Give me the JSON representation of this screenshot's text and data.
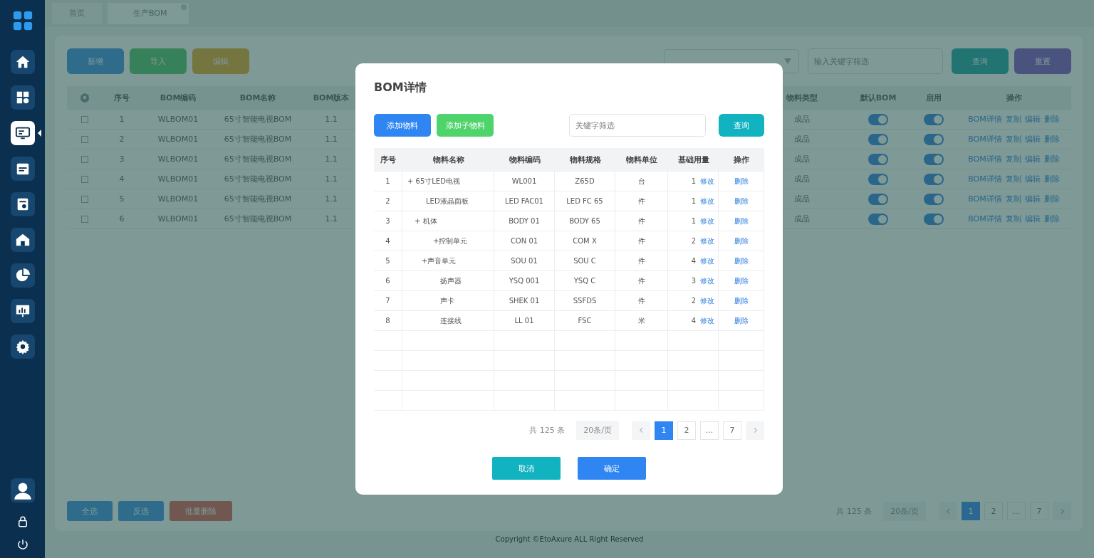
{
  "sidebar": {
    "items": [
      {
        "kind": "home",
        "selected": false
      },
      {
        "kind": "apps",
        "selected": false
      },
      {
        "kind": "monitor",
        "selected": true
      },
      {
        "kind": "calendar",
        "selected": false
      },
      {
        "kind": "report",
        "selected": false
      },
      {
        "kind": "warehouse",
        "selected": false
      },
      {
        "kind": "pie",
        "selected": false
      },
      {
        "kind": "chart",
        "selected": false
      },
      {
        "kind": "settings",
        "selected": false
      }
    ],
    "bottom": [
      {
        "kind": "user"
      },
      {
        "kind": "lock"
      },
      {
        "kind": "power"
      }
    ]
  },
  "tabs": [
    {
      "label": "首页",
      "selected": false
    },
    {
      "label": "生产BOM",
      "selected": true
    }
  ],
  "toolbar": {
    "buttons": [
      "新增",
      "导入",
      "编辑"
    ],
    "search": {
      "placeholder": "输入关键字筛选"
    },
    "actions": [
      "查询",
      "重置"
    ]
  },
  "table": {
    "columns": [
      "序号",
      "BOM编码",
      "BOM名称",
      "BOM版本",
      "物料类型",
      "默认BOM",
      "启用",
      "操作"
    ],
    "rows": [
      {
        "cells": [
          "1",
          "WLBOM01",
          "65寸智能电视BOM",
          "1.1",
          "成品"
        ],
        "checked": false,
        "default_on": true,
        "enabled": true,
        "actions": [
          "BOM详情",
          "复制",
          "编辑",
          "删除"
        ]
      },
      {
        "cells": [
          "2",
          "WLBOM01",
          "65寸智能电视BOM",
          "1.1",
          "成品"
        ],
        "checked": false,
        "default_on": true,
        "enabled": true,
        "actions": [
          "BOM详情",
          "复制",
          "编辑",
          "删除"
        ]
      },
      {
        "cells": [
          "3",
          "WLBOM01",
          "65寸智能电视BOM",
          "1.1",
          "成品"
        ],
        "checked": false,
        "default_on": true,
        "enabled": true,
        "actions": [
          "BOM详情",
          "复制",
          "编辑",
          "删除"
        ]
      },
      {
        "cells": [
          "4",
          "WLBOM01",
          "65寸智能电视BOM",
          "1.1",
          "成品"
        ],
        "checked": false,
        "default_on": true,
        "enabled": true,
        "actions": [
          "BOM详情",
          "复制",
          "编辑",
          "删除"
        ]
      },
      {
        "cells": [
          "5",
          "WLBOM01",
          "65寸智能电视BOM",
          "1.1",
          "成品"
        ],
        "checked": false,
        "default_on": true,
        "enabled": true,
        "actions": [
          "BOM详情",
          "复制",
          "编辑",
          "删除"
        ]
      },
      {
        "cells": [
          "6",
          "WLBOM01",
          "65寸智能电视BOM",
          "1.1",
          "成品"
        ],
        "checked": false,
        "default_on": true,
        "enabled": true,
        "actions": [
          "BOM详情",
          "复制",
          "编辑",
          "删除"
        ]
      }
    ]
  },
  "bulk_buttons": [
    "全选",
    "反选",
    "批量删除"
  ],
  "pagination": {
    "total": "共 125 条",
    "page_size": "20条/页",
    "pages": [
      {
        "label": "1",
        "selected": true
      },
      {
        "label": "2",
        "selected": false
      },
      {
        "label": "...",
        "selected": false
      },
      {
        "label": "7",
        "selected": false
      }
    ]
  },
  "footer": "Copyright ©EtoAxure ALL Right Reserved",
  "dialog": {
    "title": "BOM详情",
    "buttons": [
      {
        "label": "添加物料",
        "color": "#2f86f2"
      },
      {
        "label": "添加子物料",
        "color": "#4fd46c"
      }
    ],
    "search": {
      "placeholder": "关键字筛选"
    },
    "query": "查询",
    "columns": [
      "序号",
      "物料名称",
      "物料编码",
      "物料规格",
      "物料单位",
      "基础用量",
      "操作"
    ],
    "items": [
      {
        "no": "1",
        "name": "+ 65寸LED电视",
        "code": "WL001",
        "spec": "Z65D",
        "unit": "台",
        "qty": "1",
        "edit": "修改",
        "delete": "删除",
        "children": [
          {
            "no": "2",
            "name": "LED液晶面板",
            "code": "LED FAC01",
            "spec": "LED FC 65",
            "unit": "件",
            "qty": "1",
            "edit": "修改",
            "delete": "删除"
          },
          {
            "no": "3",
            "name": "+ 机体",
            "code": "BODY 01",
            "spec": "BODY 65",
            "unit": "件",
            "qty": "1",
            "edit": "修改",
            "delete": "删除",
            "children": [
              {
                "no": "4",
                "name": "+控制单元",
                "code": "CON 01",
                "spec": "COM X",
                "unit": "件",
                "qty": "2",
                "edit": "修改",
                "delete": "删除"
              },
              {
                "no": "5",
                "name": "+声音单元",
                "code": "SOU 01",
                "spec": "SOU C",
                "unit": "件",
                "qty": "4",
                "edit": "修改",
                "delete": "删除",
                "children": [
                  {
                    "no": "6",
                    "name": "扬声器",
                    "code": "YSQ 001",
                    "spec": "YSQ C",
                    "unit": "件",
                    "qty": "3",
                    "edit": "修改",
                    "delete": "删除"
                  },
                  {
                    "no": "7",
                    "name": "声卡",
                    "code": "SHEK 01",
                    "spec": "SSFDS",
                    "unit": "件",
                    "qty": "2",
                    "edit": "修改",
                    "delete": "删除"
                  },
                  {
                    "no": "8",
                    "name": "连接线",
                    "code": "LL 01",
                    "spec": "FSC",
                    "unit": "米",
                    "qty": "4",
                    "edit": "修改",
                    "delete": "删除"
                  }
                ]
              }
            ]
          }
        ]
      }
    ],
    "pagination": {
      "total": "共 125 条",
      "page_size": "20条/页",
      "pages": [
        {
          "label": "1",
          "selected": true
        },
        {
          "label": "2",
          "selected": false
        },
        {
          "label": "...",
          "selected": false
        },
        {
          "label": "7",
          "selected": false
        }
      ]
    },
    "footer_buttons": [
      {
        "label": "取消",
        "color": "#10b3bf"
      },
      {
        "label": "确定",
        "color": "#2f86f2"
      }
    ]
  }
}
